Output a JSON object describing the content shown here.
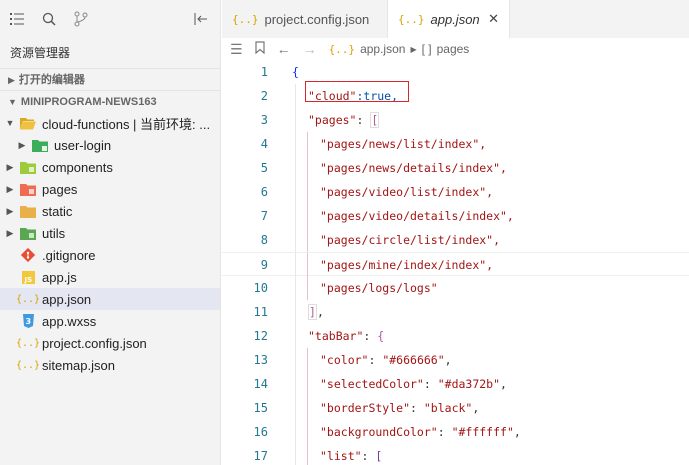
{
  "sidebar": {
    "title": "资源管理器",
    "section_open_editors": "打开的编辑器",
    "section_project": "MINIPROGRAM-NEWS163",
    "tree": [
      {
        "label": "cloud-functions | 当前环境: ...",
        "indent": 1,
        "chevron": "down",
        "icon": "folder-open-icon"
      },
      {
        "label": "user-login",
        "indent": 2,
        "chevron": "right",
        "icon": "cloud-folder-icon"
      },
      {
        "label": "components",
        "indent": 1,
        "chevron": "right",
        "icon": "components-folder-icon"
      },
      {
        "label": "pages",
        "indent": 1,
        "chevron": "right",
        "icon": "pages-folder-icon"
      },
      {
        "label": "static",
        "indent": 1,
        "chevron": "right",
        "icon": "static-folder-icon"
      },
      {
        "label": "utils",
        "indent": 1,
        "chevron": "right",
        "icon": "utils-folder-icon"
      },
      {
        "label": ".gitignore",
        "indent": 1,
        "chevron": "",
        "icon": "git-icon"
      },
      {
        "label": "app.js",
        "indent": 1,
        "chevron": "",
        "icon": "js-file-icon"
      },
      {
        "label": "app.json",
        "indent": 1,
        "chevron": "",
        "icon": "json-file-icon",
        "selected": true
      },
      {
        "label": "app.wxss",
        "indent": 1,
        "chevron": "",
        "icon": "css-file-icon"
      },
      {
        "label": "project.config.json",
        "indent": 1,
        "chevron": "",
        "icon": "json-file-icon"
      },
      {
        "label": "sitemap.json",
        "indent": 1,
        "chevron": "",
        "icon": "json-file-icon"
      }
    ]
  },
  "tabs": [
    {
      "label": "project.config.json",
      "active": false
    },
    {
      "label": "app.json",
      "active": true
    }
  ],
  "breadcrumb": {
    "file": "app.json",
    "symbol": "pages"
  },
  "editor": {
    "highlight_line": 2,
    "current_line": 9,
    "lines": [
      {
        "n": "1"
      },
      {
        "n": "2"
      },
      {
        "n": "3"
      },
      {
        "n": "4"
      },
      {
        "n": "5"
      },
      {
        "n": "6"
      },
      {
        "n": "7"
      },
      {
        "n": "8"
      },
      {
        "n": "9"
      },
      {
        "n": "10"
      },
      {
        "n": "11"
      },
      {
        "n": "12"
      },
      {
        "n": "13"
      },
      {
        "n": "14"
      },
      {
        "n": "15"
      },
      {
        "n": "16"
      },
      {
        "n": "17"
      }
    ],
    "code": {
      "l1": "{",
      "l2_key": "\"cloud\"",
      "l2_rest": ":true,",
      "l3_key": "\"pages\"",
      "l3_sep": ": ",
      "l3_br": "[",
      "l4": "\"pages/news/list/index\",",
      "l5": "\"pages/news/details/index\",",
      "l6": "\"pages/video/list/index\",",
      "l7": "\"pages/video/details/index\",",
      "l8": "\"pages/circle/list/index\",",
      "l9": "\"pages/mine/index/index\",",
      "l10": "\"pages/logs/logs\"",
      "l11_br": "]",
      "l11_rest": ",",
      "l12_key": "\"tabBar\"",
      "l12_sep": ": ",
      "l12_br": "{",
      "l13_key": "\"color\"",
      "l13_val": "\"#666666\"",
      "l14_key": "\"selectedColor\"",
      "l14_val": "\"#da372b\"",
      "l15_key": "\"borderStyle\"",
      "l15_val": "\"black\"",
      "l16_key": "\"backgroundColor\"",
      "l16_val": "\"#ffffff\"",
      "l17_key": "\"list\"",
      "l17_br": "["
    }
  },
  "colors": {
    "accent_red": "#d9262c",
    "json_icon": "#d6a300",
    "line_number": "#237893",
    "string": "#a31515",
    "selection_bg": "#e4e6f1"
  }
}
